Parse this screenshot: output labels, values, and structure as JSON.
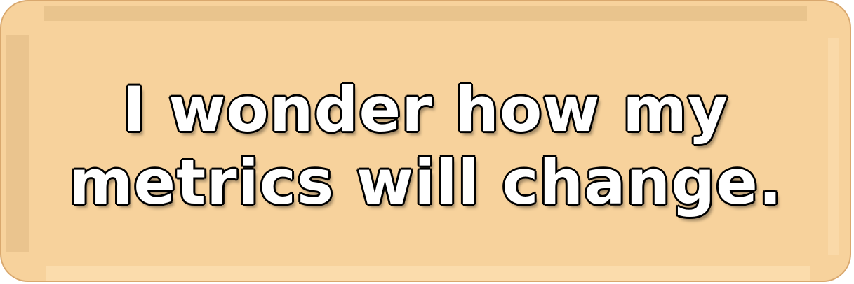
{
  "caption": {
    "line1": "I wonder how my",
    "line2": "metrics will change."
  },
  "colors": {
    "panel_background": "#f7d29c",
    "panel_border": "#d9a86e",
    "text_fill": "#ffffff",
    "text_outline": "#000000"
  }
}
